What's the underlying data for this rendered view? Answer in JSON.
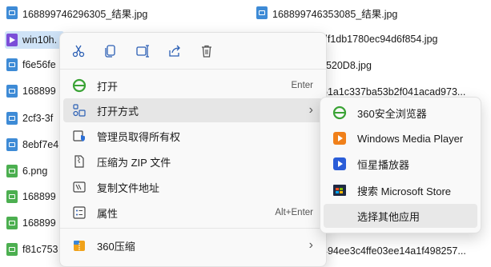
{
  "files_left": [
    {
      "name": "168899746296305_结果.jpg",
      "type": "jpg"
    },
    {
      "name": "win10h.",
      "type": "video",
      "selected": true
    },
    {
      "name": "f6e56fe",
      "type": "jpg"
    },
    {
      "name": "168899",
      "type": "jpg"
    },
    {
      "name": "2cf3-3f",
      "type": "jpg"
    },
    {
      "name": "8ebf7e4",
      "type": "jpg"
    },
    {
      "name": "6.png",
      "type": "png"
    },
    {
      "name": "168899",
      "type": "png"
    },
    {
      "name": "168899",
      "type": "png"
    },
    {
      "name": "f81c753",
      "type": "png"
    }
  ],
  "files_right": [
    {
      "name": "168899746353085_结果.jpg",
      "type": "jpg"
    },
    {
      "name": "34df1db1780ec94d6f854.jpg",
      "type": "jpg"
    },
    {
      "name": "2520D8.jpg",
      "type": "jpg"
    },
    {
      "name": "51a1c337ba53b2f041acad973...",
      "type": "jpg"
    },
    {
      "name": "494ee3c4ffe03ee14a1f498257...",
      "type": "png"
    }
  ],
  "context_menu": {
    "quick_actions": [
      "cut-icon",
      "copy-icon",
      "rename-icon",
      "share-icon",
      "delete-icon"
    ],
    "items": [
      {
        "label": "打开",
        "shortcut": "Enter",
        "icon": "ie-icon"
      },
      {
        "label": "打开方式",
        "shortcut": "",
        "icon": "open-with-icon",
        "submenu": true,
        "highlighted": true
      },
      {
        "label": "管理员取得所有权",
        "shortcut": "",
        "icon": "admin-shield-icon"
      },
      {
        "label": "压缩为 ZIP 文件",
        "shortcut": "",
        "icon": "zip-icon"
      },
      {
        "label": "复制文件地址",
        "shortcut": "",
        "icon": "copy-path-icon"
      },
      {
        "label": "属性",
        "shortcut": "Alt+Enter",
        "icon": "properties-icon"
      },
      {
        "label": "360压缩",
        "shortcut": "",
        "icon": "360zip-icon",
        "submenu": true
      }
    ]
  },
  "submenu": {
    "items": [
      {
        "label": "360安全浏览器",
        "icon": "360browser-icon"
      },
      {
        "label": "Windows Media Player",
        "icon": "wmp-icon"
      },
      {
        "label": "恒星播放器",
        "icon": "hengxing-player-icon"
      },
      {
        "label": "搜索 Microsoft Store",
        "icon": "store-icon"
      },
      {
        "label": "选择其他应用",
        "icon": "",
        "highlighted": true
      }
    ]
  },
  "colors": {
    "selection": "#cfe3f7",
    "menu_bg": "#f9f9f9",
    "highlight": "#e6e6e6",
    "jpg": "#3e8bd6",
    "png": "#4caf50",
    "video": "#7b4ed8"
  }
}
